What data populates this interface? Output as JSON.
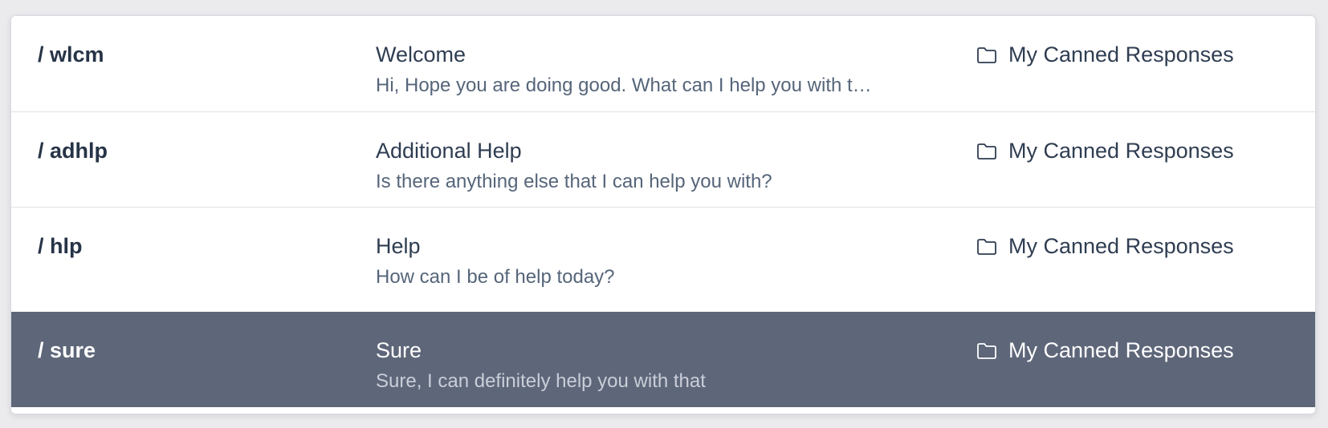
{
  "canned_responses": [
    {
      "shortcut": "/ wlcm",
      "title": "Welcome",
      "preview": "Hi, Hope you are doing good. What can I help you with t…",
      "folder": "My Canned Responses",
      "selected": false
    },
    {
      "shortcut": "/ adhlp",
      "title": "Additional Help",
      "preview": "Is there anything else that I can help you with?",
      "folder": "My Canned Responses",
      "selected": false
    },
    {
      "shortcut": "/ hlp",
      "title": "Help",
      "preview": "How can I be of help today?",
      "folder": "My Canned Responses",
      "selected": false
    },
    {
      "shortcut": "/ sure",
      "title": "Sure",
      "preview": "Sure, I can definitely help you with that",
      "folder": "My Canned Responses",
      "selected": true
    }
  ],
  "colors": {
    "selected_row_background": "#5e6679",
    "text_primary": "#2f3d52",
    "text_secondary": "#56657a"
  }
}
